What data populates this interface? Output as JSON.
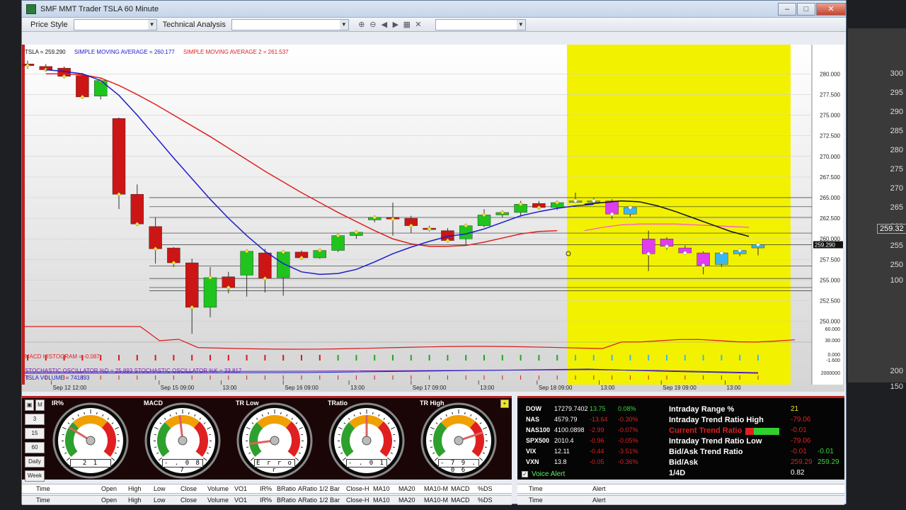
{
  "window": {
    "title": "SMF MMT Trader TSLA  60 Minute",
    "controls": [
      "minimize",
      "maximize",
      "close"
    ]
  },
  "toolbar": {
    "price_style_label": "Price Style",
    "technical_analysis_label": "Technical Analysis",
    "icons": [
      "zoom-in-icon",
      "zoom-out-icon",
      "arrow-left-icon",
      "arrow-right-icon",
      "fit-icon",
      "cross-icon"
    ]
  },
  "chart": {
    "header": {
      "symbol": "TSLA = 259.290",
      "sma1": "SIMPLE MOVING AVERAGE = 260.177",
      "sma2": "SIMPLE MOVING AVERAGE 2 = 261.537"
    },
    "macd_label": "MACD HISTOGRAM = -0.087",
    "stoch_label": "STOCHASTIC OSCILLATOR %D = 25.893   STOCHASTIC OSCILLATOR %K = 33.817",
    "volume_label": "TSLA VOLUME = 741893",
    "price_tag": "259.290",
    "colors": {
      "up": "#1fc41f",
      "down": "#cc1515",
      "sma1": "#1c1ccc",
      "sma2": "#e02020",
      "forecast_band": "#f2f200",
      "forecast_line": "#111111",
      "forecast_sma2": "#ff44ee",
      "marker": "#f2e62a"
    }
  },
  "chart_data": {
    "type": "candlestick",
    "title": "SMF MMT Trader TSLA  60 Minute",
    "x_tick_labels": [
      "Sep 12 12:00",
      "Sep 15 09:00",
      "13:00",
      "Sep 16 09:00",
      "13:00",
      "Sep 17 09:00",
      "13:00",
      "Sep 18 09:00",
      "13:00",
      "Sep 19 09:00",
      "13:00"
    ],
    "y_tick_labels": [
      "280.000",
      "277.500",
      "275.000",
      "272.500",
      "270.000",
      "267.500",
      "265.000",
      "262.500",
      "260.000",
      "257.500",
      "255.000",
      "252.500",
      "250.000"
    ],
    "y_range": [
      248,
      282
    ],
    "lower_axis_labels": [
      "60.000",
      "30.000",
      "0.000",
      "-1.600",
      "2000000"
    ],
    "last_price": 259.29,
    "candles": [
      {
        "o": 281.2,
        "h": 281.6,
        "l": 280.6,
        "c": 281.0
      },
      {
        "o": 280.9,
        "h": 281.2,
        "l": 280.3,
        "c": 280.5
      },
      {
        "o": 280.7,
        "h": 280.9,
        "l": 279.6,
        "c": 279.7
      },
      {
        "o": 279.8,
        "h": 280.1,
        "l": 277.1,
        "c": 277.2
      },
      {
        "o": 277.3,
        "h": 279.4,
        "l": 276.9,
        "c": 279.2
      },
      {
        "o": 274.6,
        "h": 274.7,
        "l": 263.6,
        "c": 265.4
      },
      {
        "o": 265.4,
        "h": 266.6,
        "l": 261.6,
        "c": 261.8
      },
      {
        "o": 261.5,
        "h": 262.6,
        "l": 257.0,
        "c": 258.8
      },
      {
        "o": 258.9,
        "h": 259.0,
        "l": 256.6,
        "c": 257.1
      },
      {
        "o": 257.1,
        "h": 257.6,
        "l": 248.5,
        "c": 251.7
      },
      {
        "o": 251.7,
        "h": 256.6,
        "l": 250.5,
        "c": 255.3
      },
      {
        "o": 255.4,
        "h": 256.0,
        "l": 253.4,
        "c": 254.1
      },
      {
        "o": 255.6,
        "h": 258.6,
        "l": 253.0,
        "c": 258.5
      },
      {
        "o": 258.3,
        "h": 258.8,
        "l": 253.5,
        "c": 255.2
      },
      {
        "o": 255.3,
        "h": 258.6,
        "l": 253.1,
        "c": 258.4
      },
      {
        "o": 258.4,
        "h": 258.6,
        "l": 257.6,
        "c": 257.7
      },
      {
        "o": 257.7,
        "h": 258.7,
        "l": 257.6,
        "c": 258.6
      },
      {
        "o": 258.6,
        "h": 260.6,
        "l": 258.4,
        "c": 260.4
      },
      {
        "o": 260.4,
        "h": 261.0,
        "l": 260.0,
        "c": 260.8
      },
      {
        "o": 262.3,
        "h": 262.8,
        "l": 262.0,
        "c": 262.6
      },
      {
        "o": 262.6,
        "h": 264.4,
        "l": 260.4,
        "c": 262.4
      },
      {
        "o": 262.5,
        "h": 262.8,
        "l": 260.7,
        "c": 261.6
      },
      {
        "o": 261.3,
        "h": 261.6,
        "l": 260.9,
        "c": 261.2
      },
      {
        "o": 261.0,
        "h": 261.3,
        "l": 259.6,
        "c": 259.8
      },
      {
        "o": 260.0,
        "h": 261.8,
        "l": 259.2,
        "c": 261.6
      },
      {
        "o": 261.6,
        "h": 263.6,
        "l": 261.4,
        "c": 262.9
      },
      {
        "o": 262.9,
        "h": 263.3,
        "l": 262.6,
        "c": 263.2
      },
      {
        "o": 263.2,
        "h": 264.6,
        "l": 262.7,
        "c": 264.2
      },
      {
        "o": 264.3,
        "h": 264.6,
        "l": 263.6,
        "c": 263.8
      },
      {
        "o": 263.8,
        "h": 264.6,
        "l": 263.5,
        "c": 264.4
      }
    ],
    "forecast_candles": [
      {
        "o": 264.6,
        "h": 265.6,
        "l": 264.6,
        "c": 264.6
      },
      {
        "o": 264.6,
        "h": 265.0,
        "l": 264.5,
        "c": 264.6
      },
      {
        "o": 264.6,
        "h": 264.8,
        "l": 262.4,
        "c": 263.0
      },
      {
        "o": 263.0,
        "h": 263.9,
        "l": 262.7,
        "c": 263.8
      },
      {
        "o": 260.0,
        "h": 261.0,
        "l": 256.1,
        "c": 258.2
      },
      {
        "o": 260.0,
        "h": 260.2,
        "l": 258.7,
        "c": 259.1
      },
      {
        "o": 258.9,
        "h": 259.2,
        "l": 258.1,
        "c": 258.3
      },
      {
        "o": 258.3,
        "h": 258.5,
        "l": 255.7,
        "c": 256.8
      },
      {
        "o": 256.9,
        "h": 258.5,
        "l": 256.6,
        "c": 258.3
      },
      {
        "o": 258.2,
        "h": 258.8,
        "l": 257.9,
        "c": 258.6
      },
      {
        "o": 258.9,
        "h": 259.5,
        "l": 258.0,
        "c": 259.3
      }
    ],
    "sma1": [
      280.5,
      280.3,
      280.0,
      279.2,
      277.4,
      275.0,
      272.4,
      269.8,
      267.3,
      264.8,
      262.5,
      260.4,
      258.5,
      257.0,
      256.0,
      255.7,
      255.8,
      256.3,
      257.2,
      258.2,
      259.0,
      259.7,
      260.3,
      260.6,
      261.2,
      262.0,
      262.8,
      263.3,
      263.7,
      264.0,
      264.2
    ],
    "sma2": [
      280.0,
      280.0,
      279.9,
      279.5,
      278.6,
      277.5,
      276.3,
      275.0,
      273.7,
      272.4,
      271.0,
      269.6,
      268.2,
      266.9,
      265.6,
      264.4,
      263.2,
      262.1,
      261.0,
      260.0,
      259.4,
      259.1,
      259.1,
      259.2,
      259.6,
      260.1,
      260.6,
      260.9,
      261.0
    ],
    "forecast_sma1": [
      264.2,
      264.4,
      264.6,
      264.5,
      264.0,
      263.3,
      262.5,
      261.7,
      260.9,
      260.3
    ],
    "forecast_sma2": [
      261.0,
      261.4,
      261.7,
      261.8,
      261.8,
      261.8,
      261.7,
      261.6,
      261.5,
      261.4
    ]
  },
  "gauges": {
    "side_buttons": [
      "3",
      "15",
      "60",
      "Daily",
      "Week"
    ],
    "top_buttons": [
      "▣",
      "M"
    ],
    "items": [
      {
        "title": "IR%",
        "reading": "2 1",
        "needle": -0.45
      },
      {
        "title": "MACD",
        "reading": "- . 0 8 7",
        "needle": -0.05
      },
      {
        "title": "TR Low",
        "reading": "E r r o r",
        "needle": -0.75
      },
      {
        "title": "TRatio",
        "reading": "- . 0 1",
        "needle": 0.0
      },
      {
        "title": "TR High",
        "reading": "- 7 9 . 0 6",
        "needle": 0.55
      }
    ]
  },
  "market": {
    "rows": [
      {
        "sym": "DOW",
        "last": "17279.7402",
        "chg": "13.75",
        "pct": "0.08%",
        "up": true
      },
      {
        "sym": "NAS",
        "last": "4579.79",
        "chg": "-13.64",
        "pct": "-0.30%",
        "up": false
      },
      {
        "sym": "NAS100",
        "last": "4100.0898",
        "chg": "-2.99",
        "pct": "-0.07%",
        "up": false
      },
      {
        "sym": "SPX500",
        "last": "2010.4",
        "chg": "-0.96",
        "pct": "-0.05%",
        "up": false
      },
      {
        "sym": "VIX",
        "last": "12.11",
        "chg": "-0.44",
        "pct": "-3.51%",
        "up": false
      },
      {
        "sym": "VXN",
        "last": "13.8",
        "chg": "-0.05",
        "pct": "-0.36%",
        "up": false
      }
    ],
    "voice_alert": "Voice Alert",
    "trend": [
      {
        "label": "Intraday Range %",
        "value": "21"
      },
      {
        "label": "Intraday Trend Ratio High",
        "value": "-79.06"
      },
      {
        "label": "Current Trend Ratio",
        "value": "-0.01"
      },
      {
        "label": "Intraday Trend Ratio Low",
        "value": "-79.06"
      },
      {
        "label": "Bid/Ask Trend Ratio",
        "value": "-0.01",
        "value2": "-0.01"
      },
      {
        "label": "Bid/Ask",
        "value": "259.29",
        "value2": "259.29"
      },
      {
        "label": "1/4D",
        "value": "0.82"
      }
    ]
  },
  "bottom_grid": {
    "columns": [
      "Time",
      "Open",
      "High",
      "Low",
      "Close",
      "Volume",
      "VO1",
      "IR%",
      "BRatio",
      "ARatio",
      "1/2 Bar",
      "Close-H",
      "MA10",
      "MA20",
      "MA10-M",
      "MACD",
      "%DS"
    ],
    "alert_columns": [
      "Time",
      "Alert"
    ]
  },
  "background_window": {
    "labels": [
      "300",
      "295",
      "290",
      "285",
      "280",
      "275",
      "270",
      "265",
      "260",
      "255",
      "250",
      "100",
      "200",
      "150"
    ],
    "price_chip": "259.32"
  }
}
